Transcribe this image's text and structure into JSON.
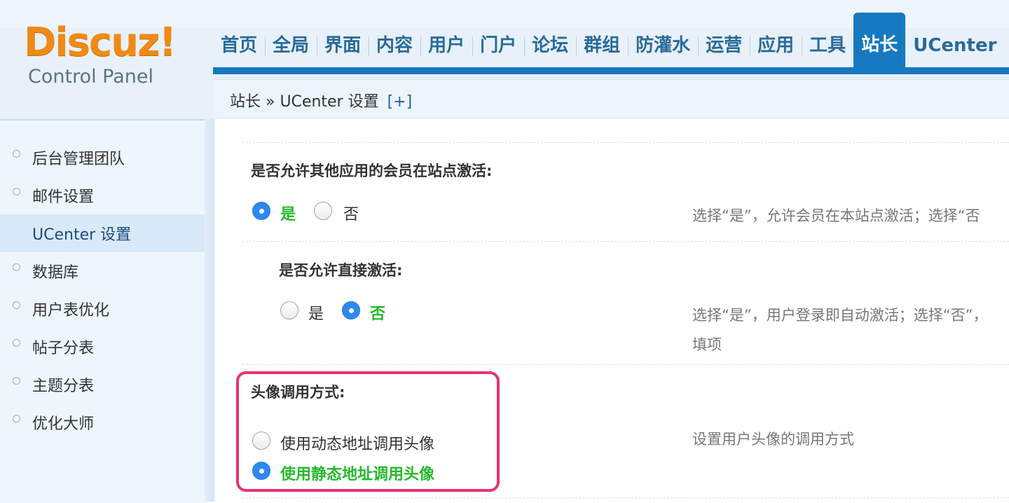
{
  "logo": {
    "brand": "Discuz!",
    "subtitle": "Control Panel"
  },
  "nav": {
    "items": [
      "首页",
      "全局",
      "界面",
      "内容",
      "用户",
      "门户",
      "论坛",
      "群组",
      "防灌水",
      "运营",
      "应用",
      "工具",
      "站长",
      "UCenter"
    ],
    "active_index": 12
  },
  "breadcrumb": {
    "text": "站长 » UCenter 设置",
    "expand": "[+]"
  },
  "sidebar": {
    "items": [
      {
        "label": "后台管理团队"
      },
      {
        "label": "邮件设置"
      },
      {
        "label": "UCenter 设置"
      },
      {
        "label": "数据库"
      },
      {
        "label": "用户表优化"
      },
      {
        "label": "帖子分表"
      },
      {
        "label": "主题分表"
      },
      {
        "label": "优化大师"
      }
    ],
    "active_index": 2
  },
  "settings": {
    "allow_activate": {
      "title": "是否允许其他应用的会员在站点激活:",
      "yes": "是",
      "no": "否",
      "selected": "yes",
      "hint": "选择“是”，允许会员在本站点激活；选择“否"
    },
    "direct_activate": {
      "title": "是否允许直接激活:",
      "yes": "是",
      "no": "否",
      "selected": "no",
      "hint_line1": "选择“是”，用户登录即自动激活；选择“否”，",
      "hint_line2": "填项"
    },
    "avatar_mode": {
      "title": "头像调用方式:",
      "option_dynamic": "使用动态地址调用头像",
      "option_static": "使用静态地址调用头像",
      "selected": "static",
      "hint": "设置用户头像的调用方式"
    }
  },
  "colors": {
    "accent": "#1679c0",
    "logo_orange": "#f08a16",
    "selected_green": "#25b92b",
    "highlight_pink": "#e8336e",
    "radio_blue": "#2f88f2"
  }
}
